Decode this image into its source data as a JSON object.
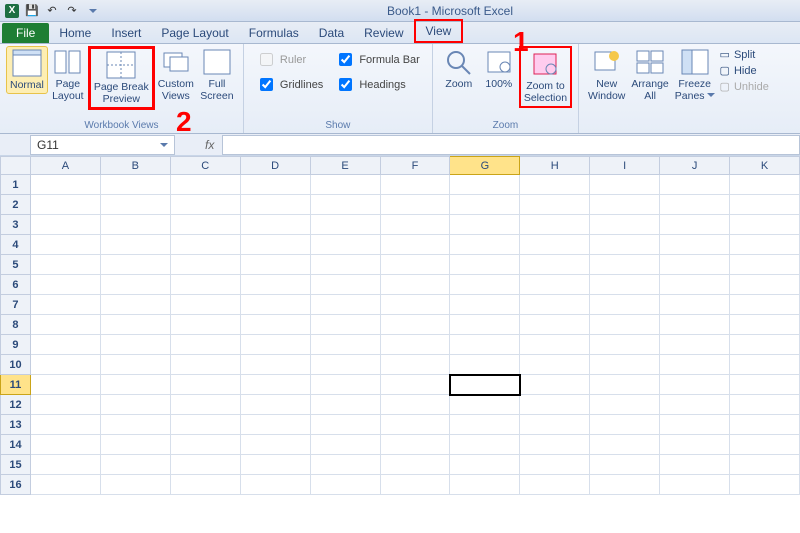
{
  "app": {
    "title": "Book1 - Microsoft Excel"
  },
  "qat": {
    "save_tip": "Save",
    "undo_tip": "Undo",
    "redo_tip": "Redo"
  },
  "tabs": {
    "file": "File",
    "home": "Home",
    "insert": "Insert",
    "page_layout": "Page Layout",
    "formulas": "Formulas",
    "data": "Data",
    "review": "Review",
    "view": "View"
  },
  "ribbon": {
    "workbook_views": {
      "label": "Workbook Views",
      "normal": "Normal",
      "page_layout": "Page\nLayout",
      "page_break": "Page Break\nPreview",
      "custom": "Custom\nViews",
      "full": "Full\nScreen"
    },
    "show": {
      "label": "Show",
      "ruler": "Ruler",
      "gridlines": "Gridlines",
      "formula_bar": "Formula Bar",
      "headings": "Headings"
    },
    "zoom": {
      "label": "Zoom",
      "zoom": "Zoom",
      "hundred": "100%",
      "zoom_sel": "Zoom to\nSelection"
    },
    "window": {
      "new_window": "New\nWindow",
      "arrange_all": "Arrange\nAll",
      "freeze_panes": "Freeze\nPanes",
      "split": "Split",
      "hide": "Hide",
      "unhide": "Unhide"
    }
  },
  "namebox": {
    "value": "G11",
    "fx": "fx"
  },
  "grid": {
    "columns": [
      "A",
      "B",
      "C",
      "D",
      "E",
      "F",
      "G",
      "H",
      "I",
      "J",
      "K"
    ],
    "rows": [
      "1",
      "2",
      "3",
      "4",
      "5",
      "6",
      "7",
      "8",
      "9",
      "10",
      "11",
      "12",
      "13",
      "14",
      "15",
      "16"
    ],
    "active_col": "G",
    "active_row": "11",
    "pagebreak_after_col": "I"
  },
  "callouts": {
    "one": "1",
    "two": "2"
  }
}
